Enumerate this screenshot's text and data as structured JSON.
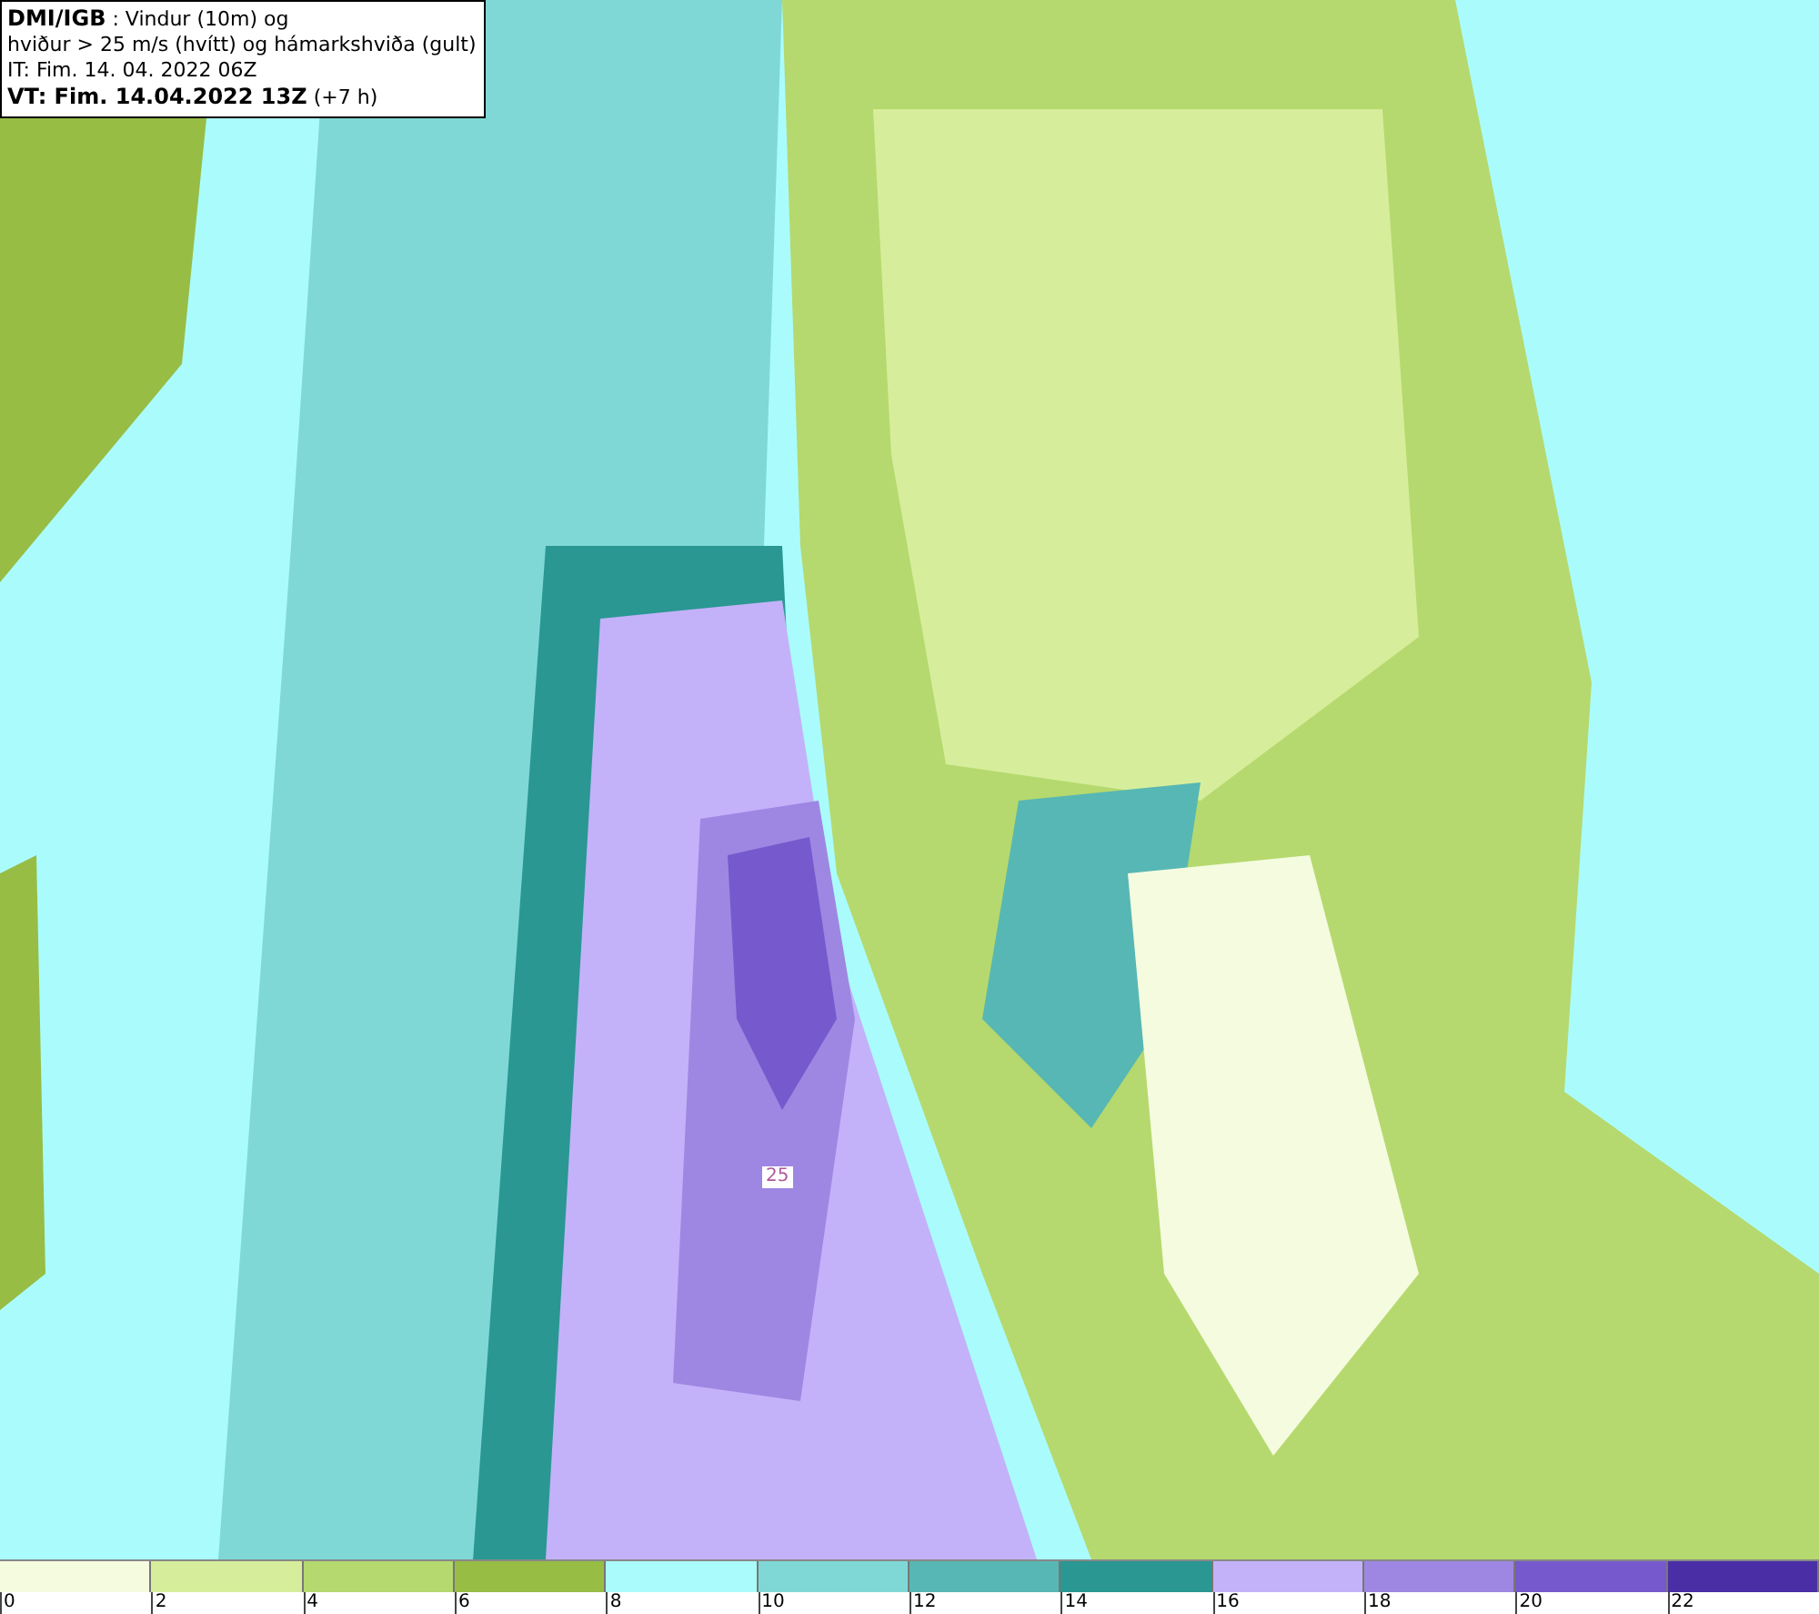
{
  "info_box": {
    "lines": [
      "**DMI/IGB** : Vindur (10m) og",
      "hviður > 25 m/s (hvítt) og hámarkshviða (gult)",
      "IT: Fim. 14. 04. 2022 06Z",
      "**VT: Fim. 14.04.2022 13Z** (+7 h)"
    ]
  },
  "map": {
    "contour_label": "25"
  },
  "legend": {
    "bins": [
      {
        "color": "#f5fbdf",
        "label": "0"
      },
      {
        "color": "#d6ee9b",
        "label": "2"
      },
      {
        "color": "#b5d96e",
        "label": "4"
      },
      {
        "color": "#97bd45",
        "label": "6"
      },
      {
        "color": "#aafcfc",
        "label": "8"
      },
      {
        "color": "#80d8d6",
        "label": "10"
      },
      {
        "color": "#57b7b4",
        "label": "12"
      },
      {
        "color": "#2a9792",
        "label": "14"
      },
      {
        "color": "#c3b2fa",
        "label": "16"
      },
      {
        "color": "#9e87e2",
        "label": "18"
      },
      {
        "color": "#7659cd",
        "label": "20"
      },
      {
        "color": "#4a2ea6",
        "label": "22"
      }
    ]
  }
}
